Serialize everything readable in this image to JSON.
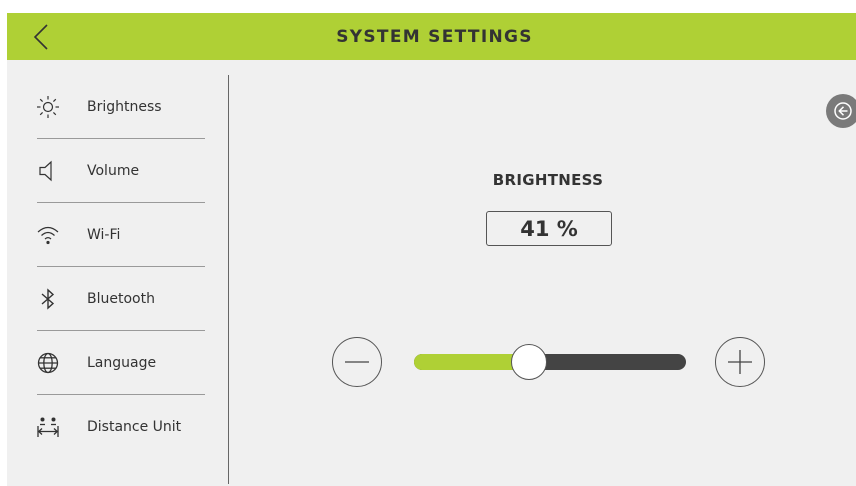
{
  "header": {
    "title": "SYSTEM SETTINGS",
    "back_icon": "chevron-left-icon"
  },
  "sidebar": {
    "items": [
      {
        "label": "Brightness",
        "icon": "sun-icon"
      },
      {
        "label": "Volume",
        "icon": "speaker-icon"
      },
      {
        "label": "Wi-Fi",
        "icon": "wifi-icon"
      },
      {
        "label": "Bluetooth",
        "icon": "bluetooth-icon"
      },
      {
        "label": "Language",
        "icon": "globe-icon"
      },
      {
        "label": "Distance Unit",
        "icon": "distance-unit-icon"
      }
    ]
  },
  "main": {
    "section_title": "BRIGHTNESS",
    "value_text": "41 %",
    "slider": {
      "value_percent": 41,
      "min": 0,
      "max": 100
    },
    "decrease_icon": "minus-icon",
    "increase_icon": "plus-icon",
    "collapse_icon": "arrow-left-circle-icon"
  },
  "colors": {
    "accent": "#afd035",
    "background": "#f0f0f0",
    "text": "#333333",
    "track": "#444444",
    "collapse_button": "#7a7a7a"
  }
}
